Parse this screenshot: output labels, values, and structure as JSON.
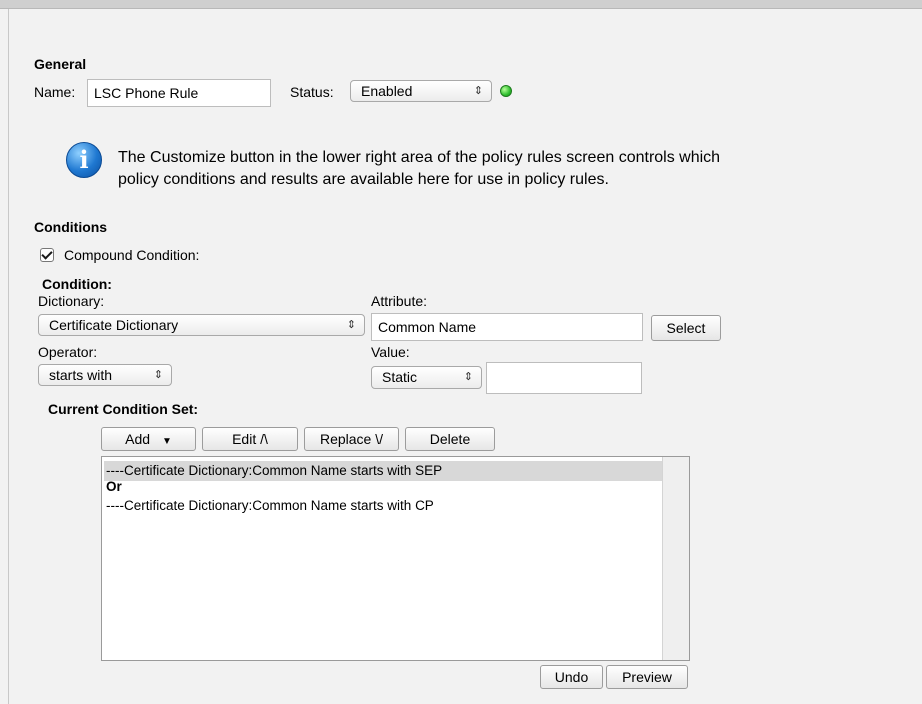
{
  "general": {
    "heading": "General",
    "name_label": "Name:",
    "name_value": "LSC Phone Rule",
    "status_label": "Status:",
    "status_value": "Enabled"
  },
  "info": {
    "line1": "The Customize button in the lower right area of the policy rules screen controls which",
    "line2": "policy conditions and results are available here for use in policy rules."
  },
  "conditions": {
    "heading": "Conditions",
    "compound_label": "Compound Condition:",
    "compound_checked": true,
    "condition_heading": "Condition:",
    "dictionary_label": "Dictionary:",
    "dictionary_value": "Certificate Dictionary",
    "attribute_label": "Attribute:",
    "attribute_value": "Common Name",
    "select_button": "Select",
    "operator_label": "Operator:",
    "operator_value": "starts with",
    "value_label": "Value:",
    "value_type": "Static",
    "value_text": ""
  },
  "condition_set": {
    "heading": "Current Condition Set:",
    "buttons": {
      "add": "Add",
      "edit": "Edit /\\",
      "replace": "Replace \\/",
      "delete": "Delete",
      "undo": "Undo",
      "preview": "Preview"
    },
    "rows": [
      "----Certificate Dictionary:Common Name starts with SEP",
      "Or",
      "----Certificate Dictionary:Common Name starts with CP"
    ]
  }
}
